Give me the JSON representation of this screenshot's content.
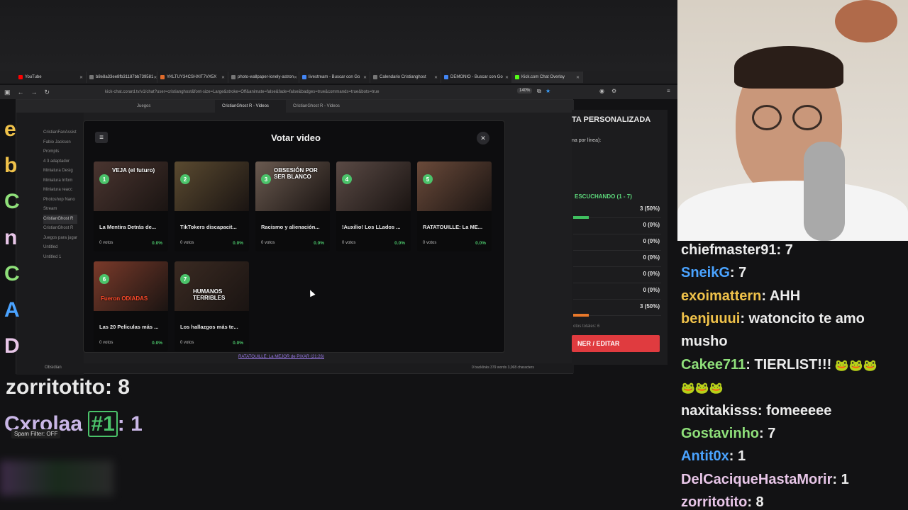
{
  "browser": {
    "tabs": [
      {
        "label": "YouTube",
        "color": "#ff0000"
      },
      {
        "label": "b8e8a33ee8fb31187bb739581",
        "color": "#777777"
      },
      {
        "label": "YKLTUY34CSHXIT7VX5X",
        "color": "#e06b2b"
      },
      {
        "label": "photo-wallpaper-lonely-astron",
        "color": "#777777"
      },
      {
        "label": "livestream - Buscar con Go",
        "color": "#4285f4"
      },
      {
        "label": "Calendario Cristianghost",
        "color": "#777777"
      },
      {
        "label": "DEMONIO - Buscar con Go",
        "color": "#4285f4"
      },
      {
        "label": "Kick.com Chat Overlay",
        "color": "#53fc18"
      }
    ],
    "url": "kick-chat.corard.tv/v1/chat?user=cristianghost&font-size=Large&stroke=Off&animate=false&fade=false&badges=true&commands=true&bots=true",
    "zoom": "140%"
  },
  "obsidian": {
    "tabs": [
      "Juegos",
      "CristianGhost R - Videos",
      "CristianGhost R - Videos"
    ],
    "tree": [
      "CristianFanAssist",
      "Fabio Jackson",
      "Prompts",
      "4 3 adaptador",
      "Miniatura Desig",
      "Miniatura Infom",
      "Miniatura reacc",
      "Photoshop Nano",
      "Stream",
      "CristianGhost R",
      "CristianGhost R",
      "Juegos para jugar",
      "Untitled",
      "Untitled 1"
    ],
    "vault": "Obsidian",
    "footer_link": "RATATOUILLE: La MEJOR de PIXAR (21:26)",
    "stats": "0 backlinks   379 words   3,068 characters"
  },
  "left_chat": {
    "blurred_letters": [
      "e",
      "b",
      "C",
      "n",
      "C",
      "A",
      "D"
    ],
    "lines": [
      {
        "user": "zorritotito",
        "text": ": 8"
      },
      {
        "user": "Cxrolaa",
        "badge": "#1",
        "text": ": 1"
      }
    ],
    "spam_filter": "Spam Filter: OFF"
  },
  "side_panel": {
    "title": "TA PERSONALIZADA",
    "subtitle": "na por línea):",
    "status": "ESCUCHANDO (1 - 7)",
    "results": [
      {
        "pct": "3 (50%)",
        "fill": 0.5,
        "color": "#3fbf5f"
      },
      {
        "pct": "0 (0%)",
        "fill": 0,
        "color": "#3fbf5f"
      },
      {
        "pct": "0 (0%)",
        "fill": 0,
        "color": "#3fbf5f"
      },
      {
        "pct": "0 (0%)",
        "fill": 0,
        "color": "#3fbf5f"
      },
      {
        "pct": "0 (0%)",
        "fill": 0,
        "color": "#3fbf5f"
      },
      {
        "pct": "0 (0%)",
        "fill": 0,
        "color": "#3fbf5f"
      },
      {
        "pct": "3 (50%)",
        "fill": 0.5,
        "color": "#e8782a"
      }
    ],
    "total": "otos totales: 6",
    "button": "NER / EDITAR"
  },
  "modal": {
    "title": "Votar video",
    "cards": [
      {
        "num": "1",
        "title": "La Mentira Detrás de...",
        "votes": "0 votos",
        "pct": "0.0%",
        "caption": "VEJA (el futuro)",
        "bg": "#4a3530"
      },
      {
        "num": "2",
        "title": "TikTokers discapacit...",
        "votes": "0 votos",
        "pct": "0.0%",
        "caption": "",
        "bg": "#5a4a30"
      },
      {
        "num": "3",
        "title": "Racismo y alienación...",
        "votes": "0 votos",
        "pct": "0.0%",
        "caption": "OBSESIÓN POR SER BLANCO",
        "bg": "#6a5a50"
      },
      {
        "num": "4",
        "title": "!Auxilio! Los LLados ...",
        "votes": "0 votos",
        "pct": "0.0%",
        "caption": "",
        "bg": "#5a4a45"
      },
      {
        "num": "5",
        "title": "RATATOUILLE: La ME...",
        "votes": "0 votos",
        "pct": "0.0%",
        "caption": "",
        "bg": "#6a4a3a"
      },
      {
        "num": "6",
        "title": "Las 20 Peliculas más ...",
        "votes": "0 votos",
        "pct": "0.0%",
        "caption": "Fueron ODIADAS",
        "bg": "#7a3a2a"
      },
      {
        "num": "7",
        "title": "Los hallazgos más te...",
        "votes": "0 votos",
        "pct": "0.0%",
        "caption": "HUMANOS TERRIBLES",
        "bg": "#3a2a22"
      }
    ]
  },
  "chat": [
    {
      "user": "chiefmaster91",
      "color": "#ececec",
      "text": ": 7"
    },
    {
      "user": "SneikG",
      "color": "#4aa3ff",
      "text": ": 7"
    },
    {
      "user": "exoimattern",
      "color": "#f0c24a",
      "text": ": AHH"
    },
    {
      "user": "benjuuui",
      "color": "#f0c24a",
      "text": ": watoncito te amo"
    },
    {
      "user": "",
      "color": "#ececec",
      "text": "musho"
    },
    {
      "user": "Cakee711",
      "color": "#8fe07a",
      "text": ": TIERLIST!!!"
    },
    {
      "user": "",
      "color": "#ececec",
      "text": ""
    },
    {
      "user": "naxitakisss",
      "color": "#ececec",
      "text": ": fomeeeee"
    },
    {
      "user": "Gostavinho",
      "color": "#8fe07a",
      "text": ": 7"
    },
    {
      "user": "Antit0x",
      "color": "#4aa3ff",
      "text": ": 1"
    },
    {
      "user": "DelCaciqueHastaMorir",
      "color": "#e8c6e8",
      "text": ": 1"
    },
    {
      "user": "zorritotito",
      "color": "#e8c6e8",
      "text": ": 8"
    }
  ]
}
